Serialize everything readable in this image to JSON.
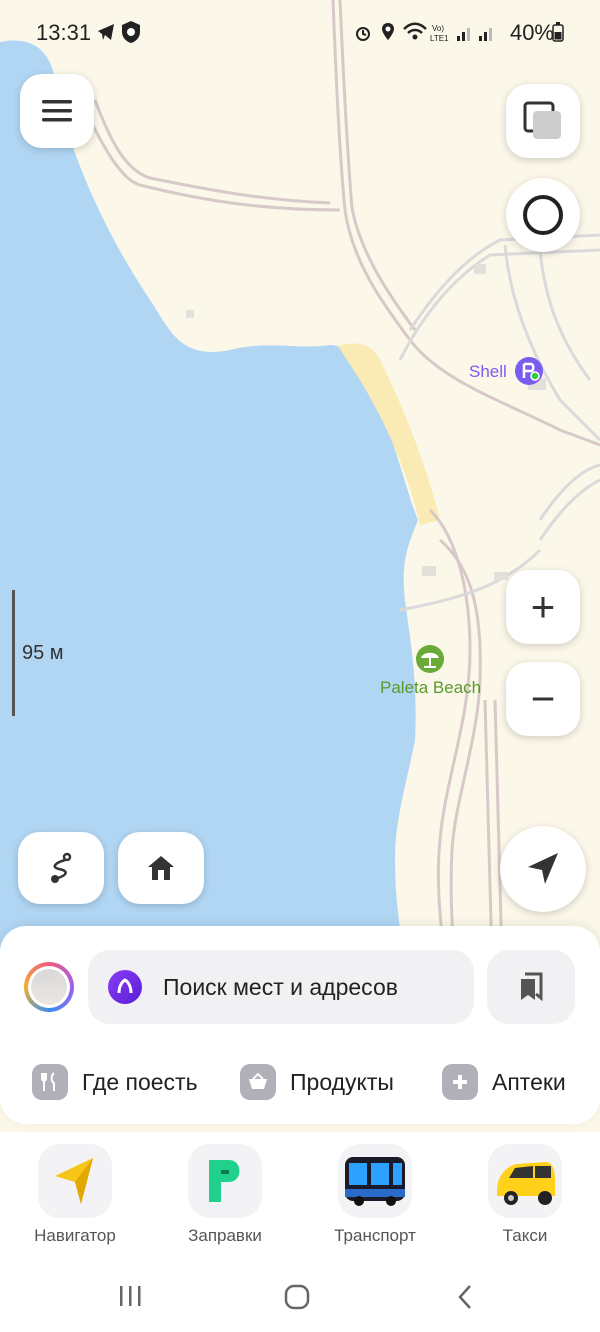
{
  "status_bar": {
    "time": "13:31",
    "battery": "40%",
    "icons": [
      "telegram-icon",
      "shield-phone-icon",
      "alarm-icon",
      "location-icon",
      "wifi-icon",
      "volte-icon",
      "signal-icon",
      "signal-icon",
      "battery-icon"
    ]
  },
  "map": {
    "scale_label": "95 м",
    "pois": [
      {
        "name": "Shell",
        "icon": "fuel-station-icon",
        "color": "#7a5cf0"
      },
      {
        "name": "Paleta Beach",
        "icon": "beach-umbrella-icon",
        "color": "#5a9a2c"
      }
    ],
    "colors": {
      "water": "#b0d6f4",
      "land": "#fbf7e9",
      "sand": "#faeab4",
      "road_outline": "#d8c9c9"
    }
  },
  "controls": {
    "menu": "menu-icon",
    "layers": "layers-icon",
    "alice": "alice-icon",
    "zoom_in": "+",
    "zoom_out": "−",
    "route": "route-icon",
    "home": "home-icon",
    "my_location": "location-arrow-icon"
  },
  "search": {
    "placeholder": "Поиск мест и адресов"
  },
  "categories": [
    {
      "label": "Где поесть",
      "icon": "fork-knife-icon"
    },
    {
      "label": "Продукты",
      "icon": "basket-icon"
    },
    {
      "label": "Аптеки",
      "icon": "plus-icon"
    }
  ],
  "apps": [
    {
      "label": "Навигатор",
      "icon": "navigator-icon"
    },
    {
      "label": "Заправки",
      "icon": "fuel-app-icon"
    },
    {
      "label": "Транспорт",
      "icon": "bus-icon"
    },
    {
      "label": "Такси",
      "icon": "taxi-icon"
    }
  ],
  "nav": [
    "recent-apps-icon",
    "home-circle-icon",
    "back-icon"
  ]
}
